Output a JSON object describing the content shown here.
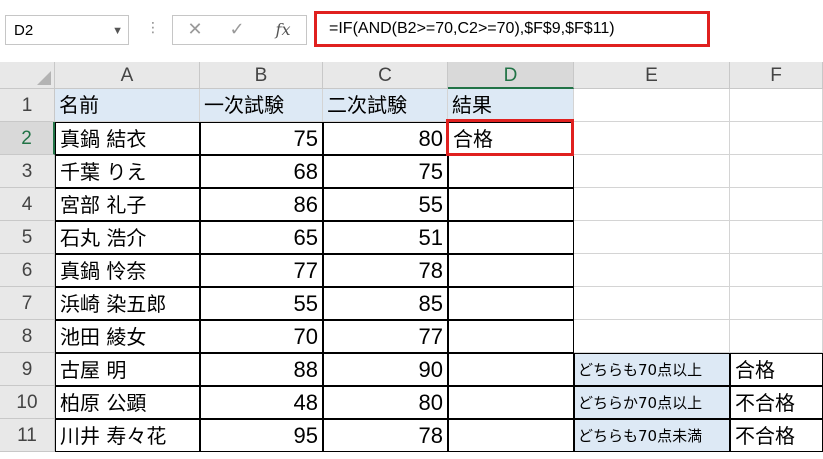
{
  "formula_bar": {
    "name_box": "D2",
    "cancel_glyph": "✕",
    "enter_glyph": "✓",
    "fx_label": "fx",
    "formula": "=IF(AND(B2>=70,C2>=70),$F$9,$F$11)"
  },
  "columns": [
    "A",
    "B",
    "C",
    "D",
    "E",
    "F"
  ],
  "rows": [
    "1",
    "2",
    "3",
    "4",
    "5",
    "6",
    "7",
    "8",
    "9",
    "10",
    "11"
  ],
  "header": {
    "name": "名前",
    "test1": "一次試験",
    "test2": "二次試験",
    "result": "結果"
  },
  "data_rows": [
    {
      "name": "真鍋 結衣",
      "test1": "75",
      "test2": "80",
      "result": "合格"
    },
    {
      "name": "千葉 りえ",
      "test1": "68",
      "test2": "75",
      "result": ""
    },
    {
      "name": "宮部 礼子",
      "test1": "86",
      "test2": "55",
      "result": ""
    },
    {
      "name": "石丸 浩介",
      "test1": "65",
      "test2": "51",
      "result": ""
    },
    {
      "name": "真鍋 怜奈",
      "test1": "77",
      "test2": "78",
      "result": ""
    },
    {
      "name": "浜崎 染五郎",
      "test1": "55",
      "test2": "85",
      "result": ""
    },
    {
      "name": "池田 綾女",
      "test1": "70",
      "test2": "77",
      "result": ""
    },
    {
      "name": "古屋 明",
      "test1": "88",
      "test2": "90",
      "result": ""
    },
    {
      "name": "柏原 公顕",
      "test1": "48",
      "test2": "80",
      "result": ""
    },
    {
      "name": "川井 寿々花",
      "test1": "95",
      "test2": "78",
      "result": ""
    }
  ],
  "lookup": [
    {
      "label": "どちらも70点以上",
      "value": "合格"
    },
    {
      "label": "どちらか70点以上",
      "value": "不合格"
    },
    {
      "label": "どちらも70点未満",
      "value": "不合格"
    }
  ],
  "colors": {
    "accent": "#217346",
    "highlight": "#e0201f",
    "header_fill": "#dde9f5"
  }
}
